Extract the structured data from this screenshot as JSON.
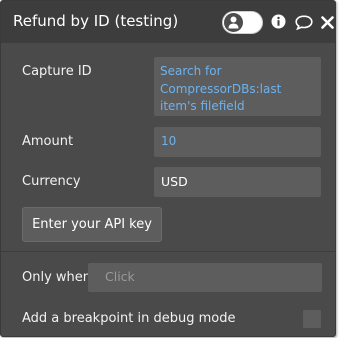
{
  "header": {
    "title": "Refund by ID (testing)",
    "icons": [
      "person-icon",
      "info-icon",
      "comment-icon",
      "close-icon"
    ]
  },
  "fields": {
    "capture_id": {
      "label": "Capture ID",
      "value": "Search for CompressorDBs:last item's filefield"
    },
    "amount": {
      "label": "Amount",
      "value": "10"
    },
    "currency": {
      "label": "Currency",
      "value": "USD"
    }
  },
  "api_key_button": "Enter your API key",
  "only_when": {
    "label": "Only when",
    "placeholder": "Click"
  },
  "breakpoint": {
    "label": "Add a breakpoint in debug mode"
  },
  "colors": {
    "panel_bg": "#4a4a4a",
    "header_bg": "#3d3d3d",
    "field_bg": "#5d5d5d",
    "dynamic_text": "#6db2ee"
  }
}
